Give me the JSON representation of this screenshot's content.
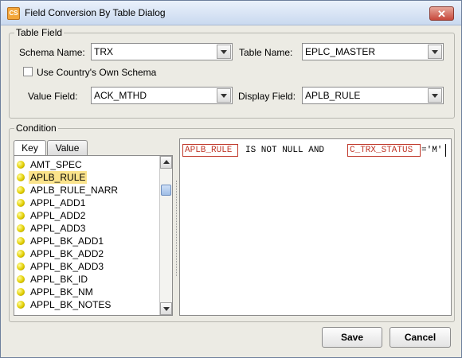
{
  "window": {
    "title": "Field Conversion By Table Dialog",
    "app_icon_text": "CS"
  },
  "table_field": {
    "group_label": "Table Field",
    "schema_label": "Schema Name:",
    "schema_value": "TRX",
    "table_label": "Table Name:",
    "table_value": "EPLC_MASTER",
    "use_country_label": "Use Country's Own Schema",
    "use_country_checked": false,
    "value_field_label": "Value Field:",
    "value_field_value": "ACK_MTHD",
    "display_field_label": "Display Field:",
    "display_field_value": "APLB_RULE"
  },
  "condition": {
    "group_label": "Condition",
    "tabs": [
      {
        "label": "Key",
        "active": true
      },
      {
        "label": "Value",
        "active": false
      }
    ],
    "items": [
      "AMT_SPEC",
      "APLB_RULE",
      "APLB_RULE_NARR",
      "APPL_ADD1",
      "APPL_ADD2",
      "APPL_ADD3",
      "APPL_BK_ADD1",
      "APPL_BK_ADD2",
      "APPL_BK_ADD3",
      "APPL_BK_ID",
      "APPL_BK_NM",
      "APPL_BK_NOTES"
    ],
    "selected_index": 1,
    "expression": {
      "field1": "APLB_RULE",
      "op1": "IS NOT NULL AND",
      "field2": "C_TRX_STATUS",
      "op2": "='M'"
    }
  },
  "buttons": {
    "save": "Save",
    "cancel": "Cancel"
  },
  "colors": {
    "selection": "#fbe38b",
    "token": "#c0392b",
    "title_bar": "#c9d9ef"
  },
  "icons": {
    "close": "close-icon",
    "item": "yellow-bullet-icon"
  }
}
